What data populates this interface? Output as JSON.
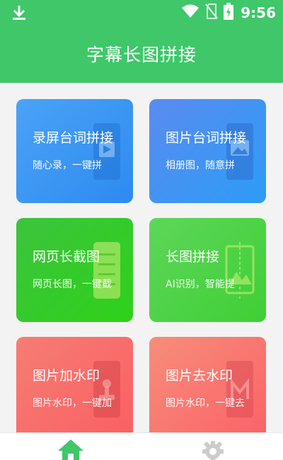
{
  "status_bar": {
    "time": "9:56",
    "icons": [
      "download-icon",
      "wifi-icon",
      "no-sim-icon",
      "battery-charging-icon"
    ]
  },
  "header": {
    "title": "字幕长图拼接"
  },
  "cards": [
    {
      "title": "录屏台词拼接",
      "subtitle": "随心录，一键拼",
      "icon": "video-icon",
      "color": "#3a96f3"
    },
    {
      "title": "图片台词拼接",
      "subtitle": "相册图，随意拼",
      "icon": "image-icon",
      "color": "#4a93f2"
    },
    {
      "title": "网页长截图",
      "subtitle": "网页长图，一键截",
      "icon": "document-icon",
      "color": "#35c92a"
    },
    {
      "title": "长图拼接",
      "subtitle": "AI识别，智能提",
      "icon": "stitch-icon",
      "color": "#4fd247"
    },
    {
      "title": "图片加水印",
      "subtitle": "图片水印，一键加",
      "icon": "stamp-icon",
      "color": "#f86e6b"
    },
    {
      "title": "图片去水印",
      "subtitle": "图片水印，一键去",
      "icon": "remove-watermark-icon",
      "color": "#f97770"
    }
  ],
  "bottom_nav": {
    "items": [
      {
        "icon": "home-icon",
        "active": true,
        "color": "#3fc76a"
      },
      {
        "icon": "gear-icon",
        "active": false,
        "color": "#cccccc"
      }
    ]
  }
}
